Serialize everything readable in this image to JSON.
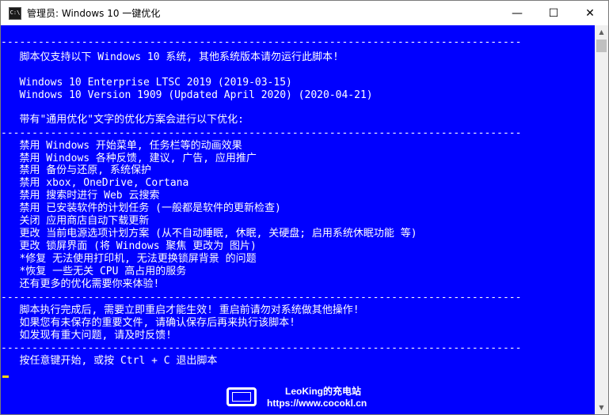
{
  "window": {
    "title": "管理员:  Windows 10 一键优化",
    "icon_label": "C:\\",
    "minimize": "—",
    "maximize": "☐",
    "close": "✕"
  },
  "console": {
    "lines": [
      "------------------------------------------------------------------------------------",
      "   脚本仅支持以下 Windows 10 系统, 其他系统版本请勿运行此脚本!",
      "",
      "   Windows 10 Enterprise LTSC 2019 (2019-03-15)",
      "   Windows 10 Version 1909 (Updated April 2020) (2020-04-21)",
      "",
      "   带有\"通用优化\"文字的优化方案会进行以下优化:",
      "------------------------------------------------------------------------------------",
      "   禁用 Windows 开始菜单, 任务栏等的动画效果",
      "   禁用 Windows 各种反馈, 建议, 广告, 应用推广",
      "   禁用 备份与还原, 系统保护",
      "   禁用 xbox, OneDrive, Cortana",
      "   禁用 搜索时进行 Web 云搜索",
      "   禁用 已安装软件的计划任务 (一般都是软件的更新检查)",
      "   关闭 应用商店自动下载更新",
      "   更改 当前电源选项计划方案 (从不自动睡眠, 休眠, 关硬盘; 启用系统休眠功能 等)",
      "   更改 锁屏界面 (将 Windows 聚焦 更改为 图片)",
      "   *修复 无法使用打印机, 无法更换锁屏背景 的问题",
      "   *恢复 一些无关 CPU 高占用的服务",
      "   还有更多的优化需要你来体验!",
      "------------------------------------------------------------------------------------",
      "   脚本执行完成后, 需要立即重启才能生效! 重启前请勿对系统做其他操作!",
      "   如果您有未保存的重要文件, 请确认保存后再来执行该脚本!",
      "   如发现有重大问题, 请及时反馈!",
      "------------------------------------------------------------------------------------",
      "   按任意键开始, 或按 Ctrl + C 退出脚本"
    ]
  },
  "watermark": {
    "name": "LeoKing的充电站",
    "url": "https://www.cocokl.cn"
  },
  "colors": {
    "console_bg": "#0000ff",
    "console_text": "#ffffff",
    "cursor": "#ffd700"
  }
}
